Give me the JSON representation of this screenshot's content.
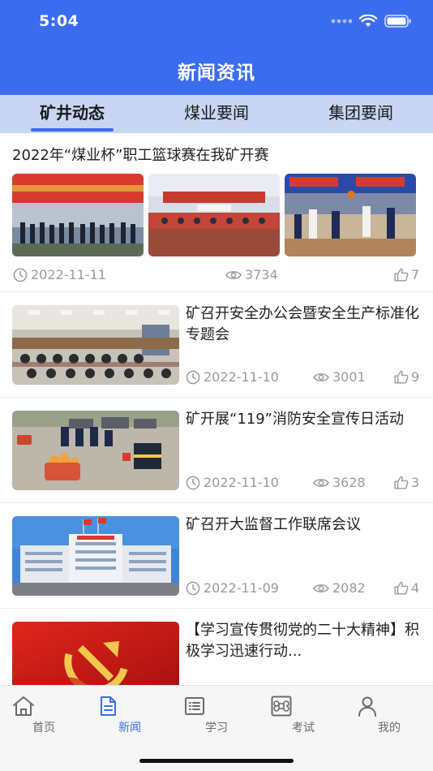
{
  "status_bar": {
    "time": "5:04"
  },
  "header": {
    "title": "新闻资讯"
  },
  "tabs": [
    {
      "label": "矿井动态",
      "active": true
    },
    {
      "label": "煤业要闻",
      "active": false
    },
    {
      "label": "集团要闻",
      "active": false
    }
  ],
  "articles": [
    {
      "title": "2022年“煤业杯”职工篮球赛在我矿开赛",
      "date": "2022-11-11",
      "views": "3734",
      "likes": "7"
    },
    {
      "title": "矿召开安全办公会暨安全生产标准化专题会",
      "date": "2022-11-10",
      "views": "3001",
      "likes": "9"
    },
    {
      "title": "矿开展“119”消防安全宣传日活动",
      "date": "2022-11-10",
      "views": "3628",
      "likes": "3"
    },
    {
      "title": "矿召开大监督工作联席会议",
      "date": "2022-11-09",
      "views": "2082",
      "likes": "4"
    },
    {
      "title": "【学习宣传贯彻党的二十大精神】积极学习迅速行动..."
    }
  ],
  "bottom_nav": [
    {
      "label": "首页",
      "icon": "home-icon",
      "active": false
    },
    {
      "label": "新闻",
      "icon": "news-document-icon",
      "active": true
    },
    {
      "label": "学习",
      "icon": "study-list-icon",
      "active": false
    },
    {
      "label": "考试",
      "icon": "command-key-icon",
      "active": false
    },
    {
      "label": "我的",
      "icon": "user-profile-icon",
      "active": false
    }
  ],
  "colors": {
    "primary": "#3b6cf0",
    "tab_background": "#c9d6f3",
    "meta_text": "#9a9a9a"
  }
}
